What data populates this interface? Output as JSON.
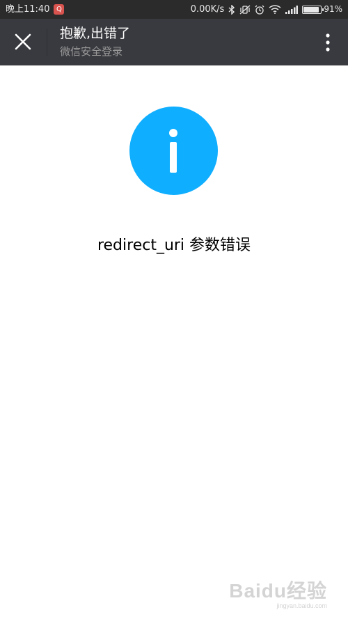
{
  "status_bar": {
    "time": "晚上11:40",
    "app_badge": "Q",
    "network_speed": "0.00K/s",
    "battery_percent": "91%",
    "battery_level": 0.91,
    "icons": [
      "bluetooth-icon",
      "vibrate-icon",
      "alarm-icon",
      "wifi-icon",
      "signal-icon",
      "battery-icon"
    ]
  },
  "header": {
    "title": "抱歉,出错了",
    "subtitle": "微信安全登录",
    "close_icon": "close-icon",
    "more_icon": "more-vertical-icon"
  },
  "content": {
    "icon": "info-icon",
    "icon_color": "#10aeff",
    "message": "redirect_uri 参数错误"
  },
  "watermark": {
    "logo": "Baidu经验",
    "url": "jingyan.baidu.com"
  },
  "colors": {
    "status_bar": "#2b2b2b",
    "title_bar": "#393a3f",
    "accent": "#10aeff"
  }
}
